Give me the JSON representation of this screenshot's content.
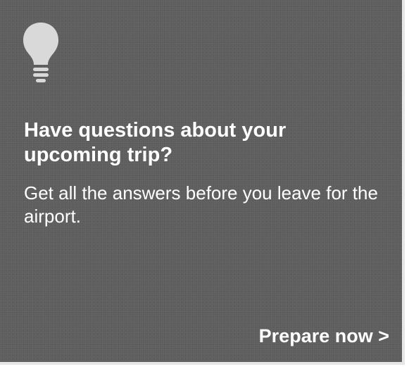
{
  "card": {
    "icon": "lightbulb-icon",
    "heading": "Have questions about your upcoming trip?",
    "subtext": "Get all the answers before you leave for the airport.",
    "cta_label": "Prepare now >"
  },
  "colors": {
    "card_background": "#5e5e5e",
    "text": "#ffffff",
    "icon": "#d9d9d9"
  }
}
